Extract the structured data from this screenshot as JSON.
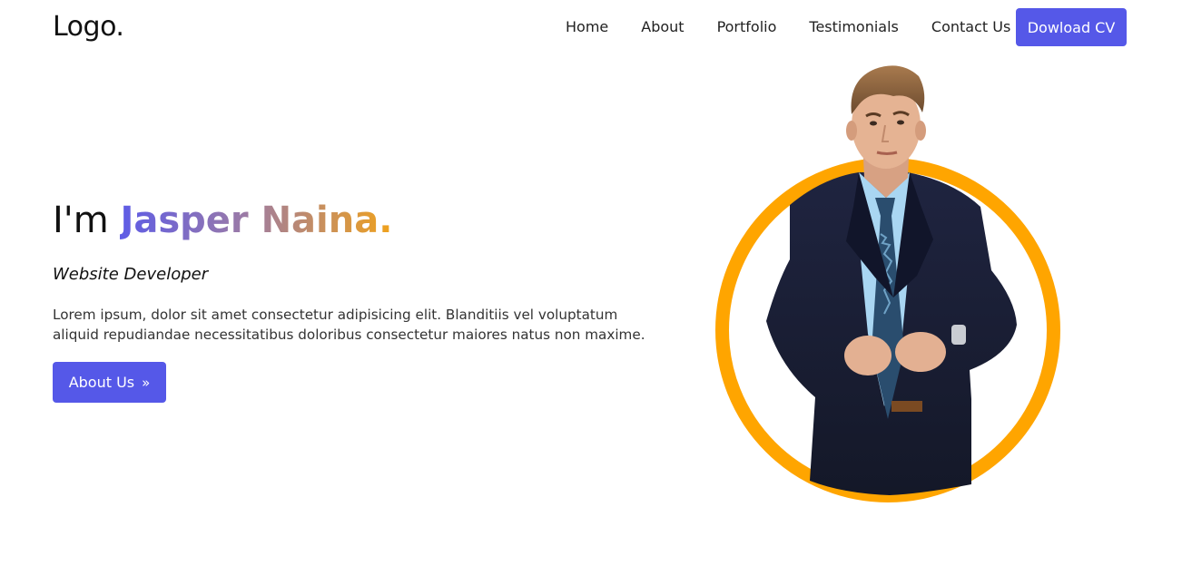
{
  "header": {
    "logo": "Logo.",
    "nav": [
      "Home",
      "About",
      "Portfolio",
      "Testimonials",
      "Contact Us"
    ],
    "cta_label": "Dowload CV"
  },
  "hero": {
    "greeting": "I'm ",
    "name": "Jasper Naina.",
    "role": "Website Developer",
    "description": "Lorem ipsum, dolor sit amet consectetur adipisicing elit. Blanditiis vel voluptatum aliquid repudiandae necessitatibus doloribus consectetur maiores natus non maxime.",
    "button_label": "About Us",
    "button_icon": "double-chevron-right-icon"
  },
  "colors": {
    "accent": "#5558e8",
    "ring": "#ffa500",
    "name_gradient_start": "#5e5ce6",
    "name_gradient_end": "#f0a21c"
  }
}
